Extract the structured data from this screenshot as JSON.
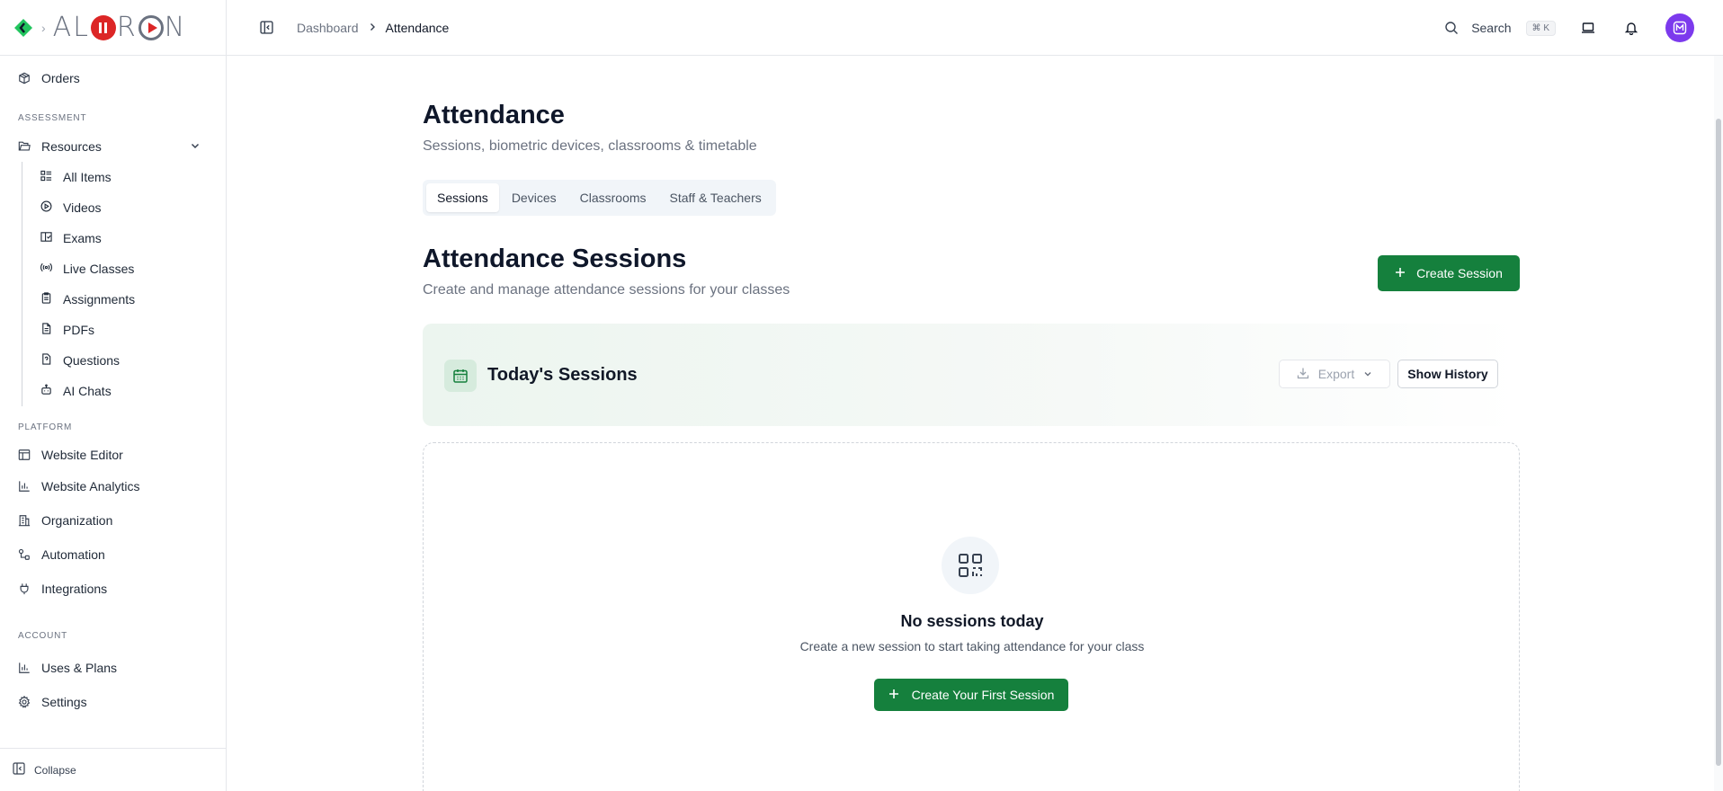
{
  "brand": {
    "name": "ALORON",
    "accent": "#15803d",
    "logo_color": "#22c55e"
  },
  "sidebar": {
    "top_item": {
      "label": "Orders",
      "icon": "package-icon"
    },
    "sections": {
      "assessment": "ASSESSMENT",
      "platform": "PLATFORM",
      "account": "ACCOUNT"
    },
    "resources": {
      "label": "Resources",
      "icon": "folder-icon",
      "items": [
        {
          "label": "All Items",
          "icon": "list-icon"
        },
        {
          "label": "Videos",
          "icon": "play-circle-icon"
        },
        {
          "label": "Exams",
          "icon": "book-check-icon"
        },
        {
          "label": "Live Classes",
          "icon": "broadcast-icon"
        },
        {
          "label": "Assignments",
          "icon": "clipboard-icon"
        },
        {
          "label": "PDFs",
          "icon": "file-icon"
        },
        {
          "label": "Questions",
          "icon": "question-file-icon"
        },
        {
          "label": "AI Chats",
          "icon": "bot-icon"
        }
      ]
    },
    "platform_items": [
      {
        "label": "Website Editor",
        "icon": "layout-icon"
      },
      {
        "label": "Website Analytics",
        "icon": "bar-chart-icon"
      },
      {
        "label": "Organization",
        "icon": "building-icon"
      },
      {
        "label": "Automation",
        "icon": "workflow-icon"
      },
      {
        "label": "Integrations",
        "icon": "plug-icon"
      }
    ],
    "account_items": [
      {
        "label": "Uses & Plans",
        "icon": "bar-chart-icon"
      },
      {
        "label": "Settings",
        "icon": "gear-icon"
      }
    ],
    "collapse_label": "Collapse"
  },
  "topbar": {
    "breadcrumb": [
      "Dashboard",
      "Attendance"
    ],
    "search_label": "Search",
    "search_shortcut": "⌘ K"
  },
  "page": {
    "title": "Attendance",
    "subtitle": "Sessions, biometric devices, classrooms & timetable",
    "tabs": [
      "Sessions",
      "Devices",
      "Classrooms",
      "Staff & Teachers"
    ],
    "active_tab": "Sessions"
  },
  "sessions": {
    "title": "Attendance Sessions",
    "subtitle": "Create and manage attendance sessions for your classes",
    "create_button": "Create Session",
    "today_title": "Today's Sessions",
    "export_label": "Export",
    "history_label": "Show History",
    "empty_title": "No sessions today",
    "empty_sub": "Create a new session to start taking attendance for your class",
    "first_button": "Create Your First Session"
  }
}
